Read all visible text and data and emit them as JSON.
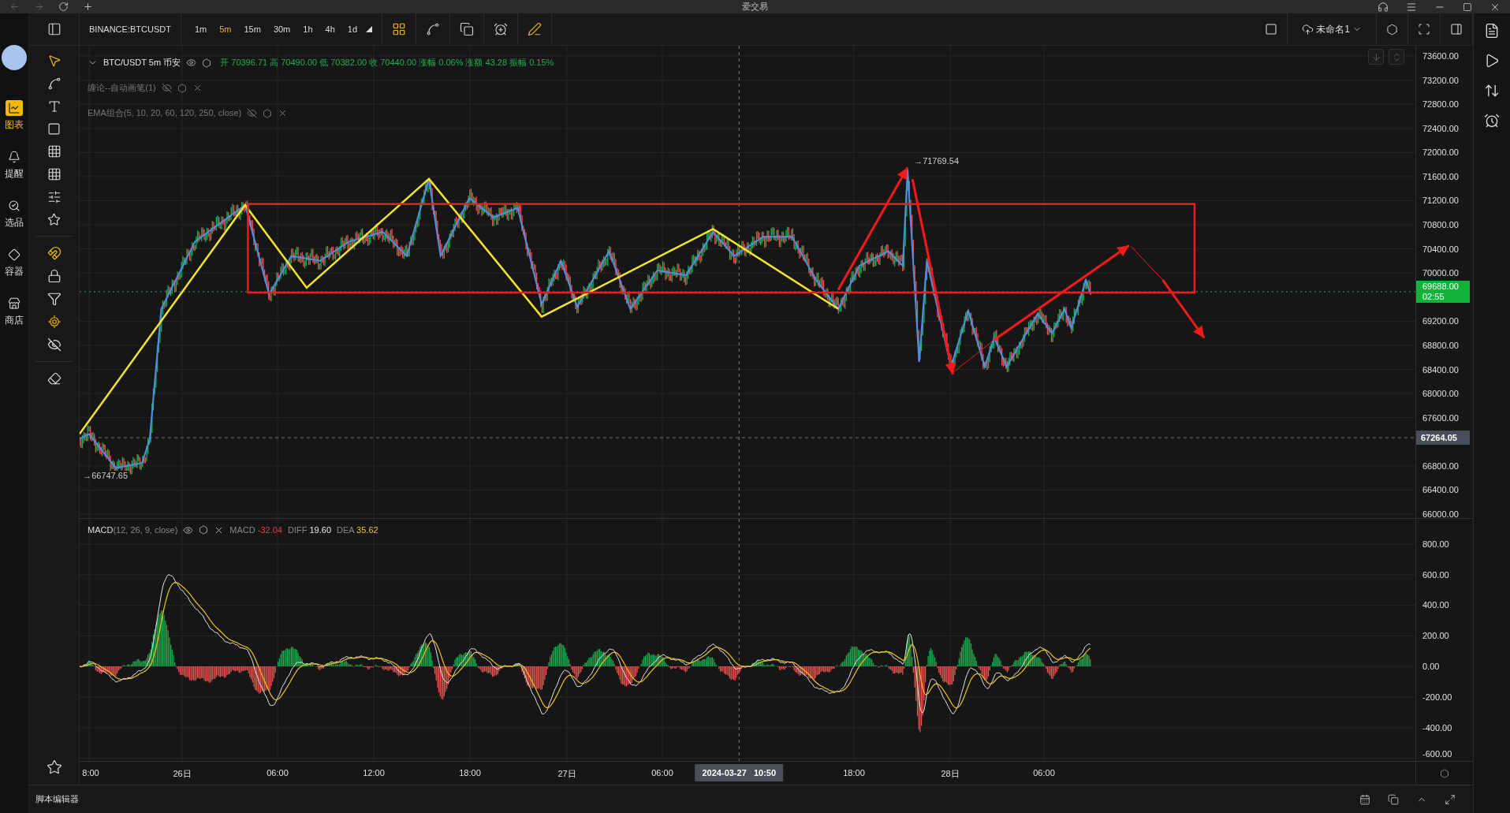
{
  "window": {
    "title": "爱交易"
  },
  "app_sidebar": {
    "items": [
      {
        "label": "图表",
        "selected": true
      },
      {
        "label": "提醒",
        "selected": false
      },
      {
        "label": "选品",
        "selected": false
      },
      {
        "label": "容器",
        "selected": false
      },
      {
        "label": "商店",
        "selected": false
      }
    ]
  },
  "toolbar": {
    "symbol": "BINANCE:BTCUSDT",
    "intervals": [
      {
        "label": "1m",
        "selected": false
      },
      {
        "label": "5m",
        "selected": true
      },
      {
        "label": "15m",
        "selected": false
      },
      {
        "label": "30m",
        "selected": false
      },
      {
        "label": "1h",
        "selected": false
      },
      {
        "label": "4h",
        "selected": false
      },
      {
        "label": "1d",
        "selected": false
      }
    ],
    "layout_name": "未命名1"
  },
  "legend": {
    "symbol": "BTC/USDT 5m 币安",
    "quote": "开 70396.71 高 70490.00 低 70382.00 收 70440.00 涨幅 0.06% 涨额 43.28 振幅 0.15%"
  },
  "indicators": [
    {
      "name": "缠论--自动画笔",
      "params": "(1)",
      "visible": false
    },
    {
      "name": "EMA组合",
      "params": "(5, 10, 20, 60, 120, 250, close)",
      "visible": false
    }
  ],
  "chart": {
    "high_label": "→71769.54",
    "low_label": "→66747.65"
  },
  "price_axis": {
    "labels": [
      "73600.00",
      "73200.00",
      "72800.00",
      "72400.00",
      "72000.00",
      "71600.00",
      "71200.00",
      "70800.00",
      "70400.00",
      "70000.00",
      "69200.00",
      "68800.00",
      "68400.00",
      "68000.00",
      "67600.00",
      "66800.00",
      "66400.00",
      "66000.00"
    ],
    "last_price": "69688.00",
    "countdown": "02:55",
    "crosshair_price": "67264.05"
  },
  "macd": {
    "name": "MACD",
    "params": "(12, 26, 9, close)",
    "values": [
      {
        "label": "MACD",
        "value": "-32.04",
        "color": "#f23645"
      },
      {
        "label": "DIFF",
        "value": "19.60",
        "color": "#e6e6e6"
      },
      {
        "label": "DEA",
        "value": "35.62",
        "color": "#f0c419"
      }
    ],
    "axis_labels": [
      "800.00",
      "600.00",
      "400.00",
      "200.00",
      "0.00",
      "-200.00",
      "-400.00",
      "-600.00"
    ]
  },
  "time_axis": {
    "labels": [
      "8:00",
      "26日",
      "06:00",
      "12:00",
      "18:00",
      "27日",
      "06:00",
      "18:00",
      "28日",
      "06:00"
    ],
    "crosshair": "2024-03-27   10:50"
  },
  "bottom_bar": {
    "title": "脚本编辑器"
  }
}
